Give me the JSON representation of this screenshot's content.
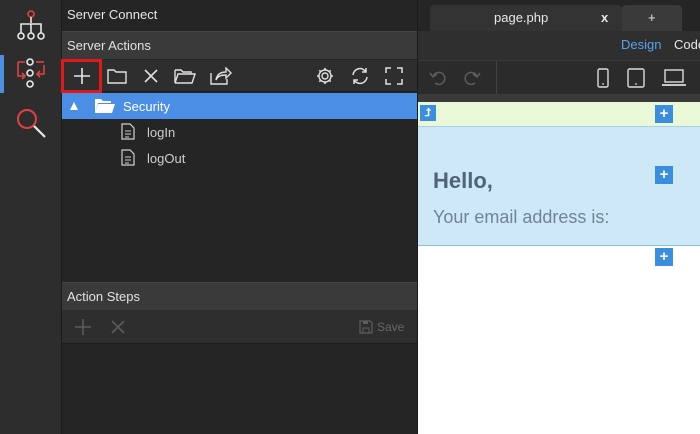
{
  "rail": {
    "items": [
      {
        "icon": "sitemap-icon"
      },
      {
        "icon": "server-connect-icon",
        "active": true
      },
      {
        "icon": "search-icon"
      }
    ]
  },
  "server_actions": {
    "app_title": "Server Connect",
    "panel_title": "Server Actions",
    "toolbar": {
      "add": "add-icon",
      "folder": "folder-icon",
      "delete": "delete-icon",
      "open": "open-folder-icon",
      "export": "export-icon",
      "settings": "gear-icon",
      "refresh": "refresh-icon",
      "expand": "fullscreen-icon"
    },
    "tree": [
      {
        "label": "Security",
        "type": "folder",
        "selected": true
      },
      {
        "label": "logIn",
        "type": "file"
      },
      {
        "label": "logOut",
        "type": "file"
      }
    ]
  },
  "action_steps": {
    "title": "Action Steps",
    "save_label": "Save"
  },
  "editor": {
    "tabs": [
      {
        "label": "page.php",
        "close": "x"
      },
      {
        "label": "+"
      }
    ],
    "views": [
      "Design",
      "Code"
    ],
    "active_view": "Design",
    "content": {
      "heading": "Hello,",
      "subtext": "Your email address is:"
    }
  },
  "colors": {
    "accent": "#4b8ee6",
    "highlight": "#e0181e",
    "add_block": "#3b8ddd"
  }
}
